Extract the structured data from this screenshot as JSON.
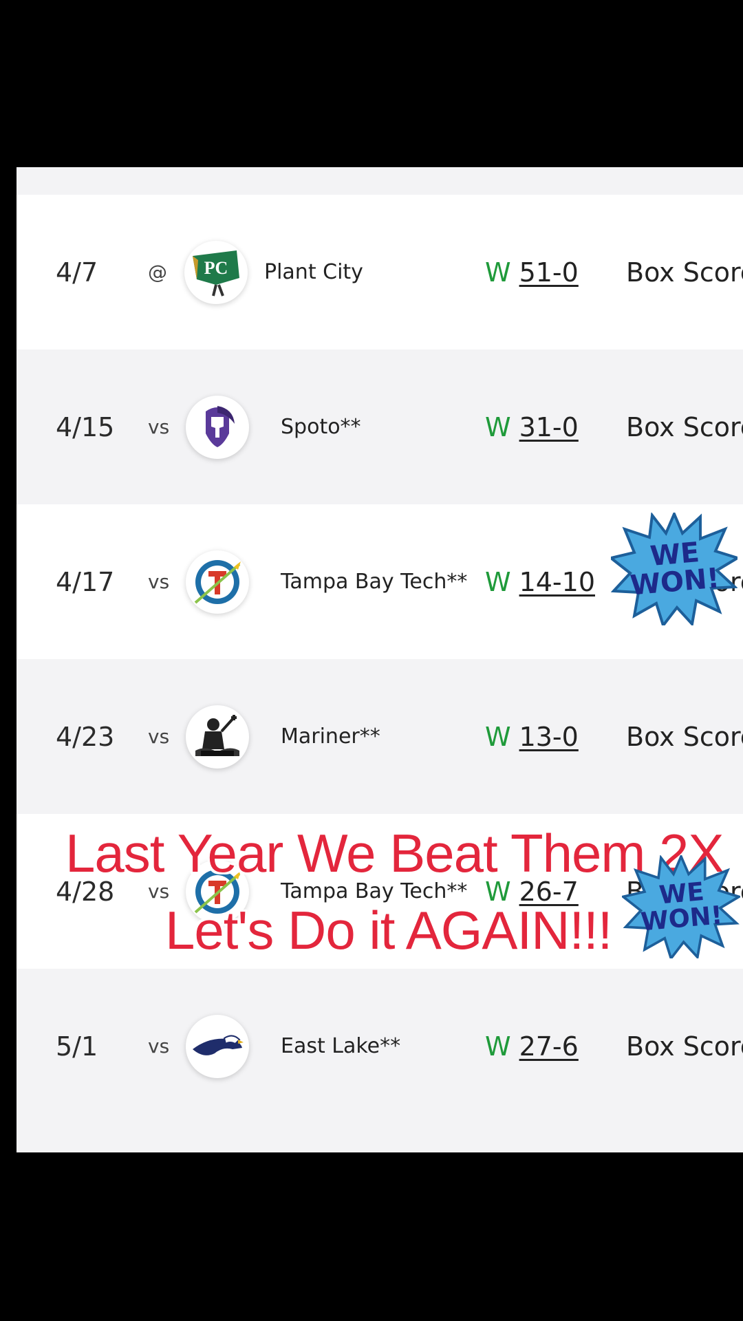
{
  "schedule": {
    "rows": [
      {
        "date": "4/7",
        "loc": "@",
        "team": "Plant City",
        "wl": "W",
        "score": "51-0",
        "link": "Box Score",
        "logo": "plant-city-logo"
      },
      {
        "date": "4/15",
        "loc": "vs",
        "team": "Spoto**",
        "wl": "W",
        "score": "31-0",
        "link": "Box Score",
        "logo": "spoto-logo"
      },
      {
        "date": "4/17",
        "loc": "vs",
        "team": "Tampa Bay Tech**",
        "wl": "W",
        "score": "14-10",
        "link": "Box Score",
        "logo": "tampa-bay-tech-logo"
      },
      {
        "date": "4/23",
        "loc": "vs",
        "team": "Mariner**",
        "wl": "W",
        "score": "13-0",
        "link": "Box Score",
        "logo": "mariner-logo"
      },
      {
        "date": "4/28",
        "loc": "vs",
        "team": "Tampa Bay Tech**",
        "wl": "W",
        "score": "26-7",
        "link": "Box Score",
        "logo": "tampa-bay-tech-logo"
      },
      {
        "date": "5/1",
        "loc": "vs",
        "team": "East Lake**",
        "wl": "W",
        "score": "27-6",
        "link": "Box Score",
        "logo": "east-lake-logo"
      }
    ]
  },
  "overlay": {
    "line1": "Last Year We Beat Them 2X",
    "line2": "Let's Do it AGAIN!!!",
    "badge": "WE WON!",
    "badge_line1": "WE",
    "badge_line2": "WON!"
  },
  "colors": {
    "win": "#1f9a3a",
    "overlay_text": "#e3263c",
    "badge_fill": "#4aa9e0",
    "badge_text": "#1d2a8a"
  }
}
